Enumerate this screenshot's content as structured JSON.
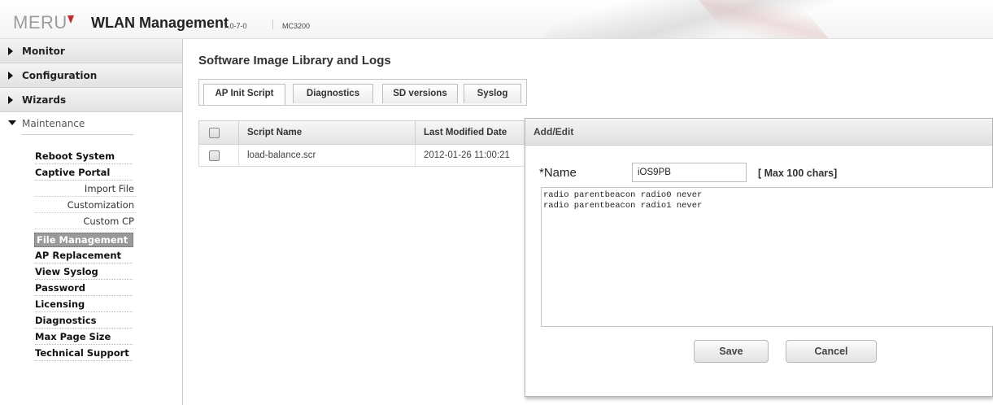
{
  "header": {
    "logo": "MERU",
    "title": "WLAN Management",
    "version": "7.0-7-0",
    "model": "MC3200",
    "accent_color": "#c0282d"
  },
  "sidebar": {
    "sections": [
      {
        "label": "Monitor",
        "icon": "triangle-right-icon"
      },
      {
        "label": "Configuration",
        "icon": "triangle-right-icon"
      },
      {
        "label": "Wizards",
        "icon": "triangle-right-icon"
      }
    ],
    "open_section": {
      "label": "Maintenance",
      "icon": "triangle-down-icon"
    },
    "items": [
      {
        "label": "Reboot System"
      },
      {
        "label": "Captive Portal"
      },
      {
        "label": "Import File"
      },
      {
        "label": "Customization"
      },
      {
        "label": "Custom CP"
      },
      {
        "label": "File Management",
        "active": true
      },
      {
        "label": "AP Replacement"
      },
      {
        "label": "View Syslog"
      },
      {
        "label": "Password"
      },
      {
        "label": "Licensing"
      },
      {
        "label": "Diagnostics"
      },
      {
        "label": "Max Page Size"
      },
      {
        "label": "Technical Support"
      }
    ]
  },
  "main": {
    "title": "Software Image Library and Logs",
    "tabs": [
      {
        "label": "AP Init Script",
        "active": true
      },
      {
        "label": "Diagnostics"
      },
      {
        "label": "SD versions"
      },
      {
        "label": "Syslog"
      }
    ],
    "table": {
      "columns": [
        "Script Name",
        "Last Modified Date"
      ],
      "rows": [
        {
          "name": "load-balance.scr",
          "modified": "2012-01-26 11:00:21"
        }
      ]
    }
  },
  "dialog": {
    "title": "Add/Edit",
    "name_label": "*Name",
    "name_value": "iOS9PB",
    "name_hint": "[ Max 100 chars]",
    "script_text": "radio parentbeacon radio0 never\nradio parentbeacon radio1 never",
    "save_label": "Save",
    "cancel_label": "Cancel"
  }
}
